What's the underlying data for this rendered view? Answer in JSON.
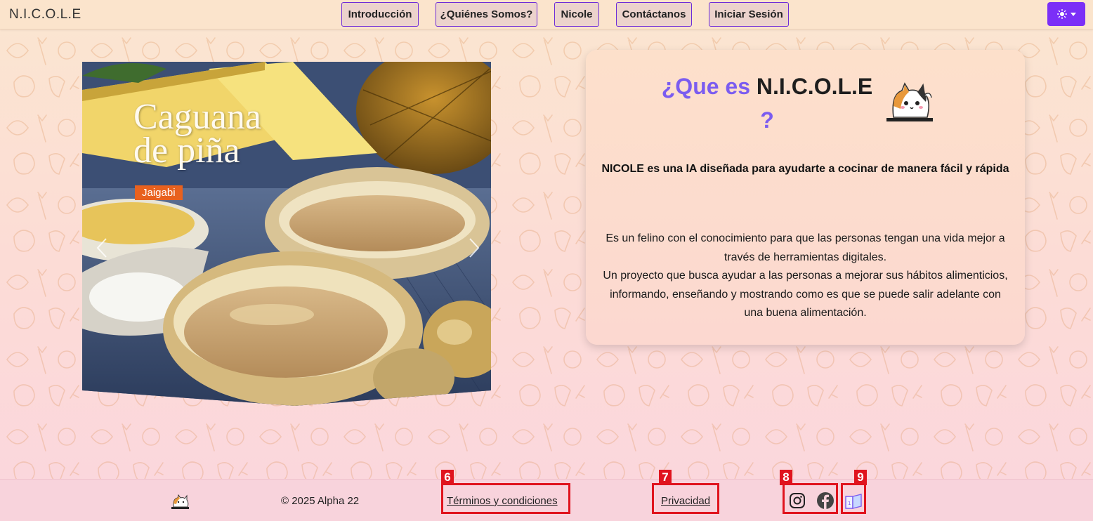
{
  "navbar": {
    "brand": "N.I.C.O.L.E",
    "links": [
      "Introducción",
      "¿Quiénes Somos?",
      "Nicole",
      "Contáctanos",
      "Iniciar Sesión"
    ],
    "theme_toggle_icon": "sun-icon"
  },
  "carousel": {
    "slide_title_line1": "Caguana",
    "slide_title_line2": "de piña",
    "slide_tag": "Jaigabi",
    "prev_icon": "chevron-left-icon",
    "next_icon": "chevron-right-icon"
  },
  "info": {
    "title_accent": "¿Que es",
    "title_main": "N.I.C.O.L.E",
    "title_end": "?",
    "subtitle": "NICOLE es una IA diseñada para ayudarte a cocinar de manera fácil y rápida",
    "body_line1": "Es un felino con el conocimiento para que las personas tengan una vida mejor a través de herramientas digitales.",
    "body_line2": "Un proyecto que busca ayudar a las personas a mejorar sus hábitos alimenticios, informando, enseñando y mostrando como es que se puede salir adelante con una buena alimentación."
  },
  "footer": {
    "copyright": "© 2025 Alpha 22",
    "terms": "Términos y condiciones",
    "privacy": "Privacidad",
    "social_icons": [
      "instagram-icon",
      "facebook-icon"
    ],
    "manual_icon": "book-icon",
    "markers": [
      "6",
      "7",
      "8",
      "9"
    ]
  },
  "colors": {
    "accent": "#7b2ff7",
    "title_accent": "#7b5cf0",
    "marker": "#e0141e",
    "slide_tag": "#e8611e"
  }
}
